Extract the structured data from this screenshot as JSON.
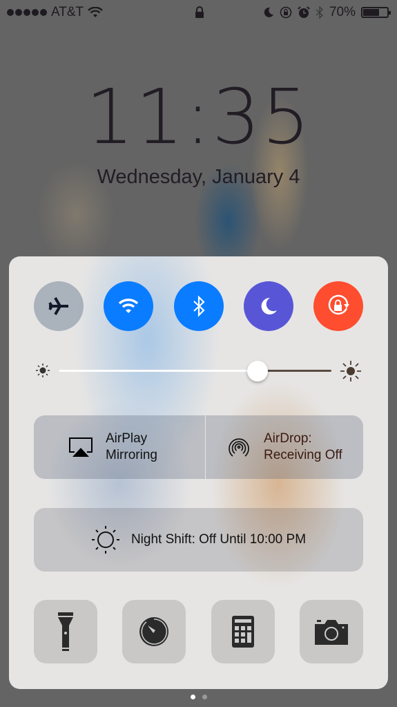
{
  "status_bar": {
    "carrier": "AT&T",
    "signal_bars": 5,
    "battery_percent": "70%",
    "battery_level": 0.7
  },
  "lock_screen": {
    "time": "11:35",
    "date": "Wednesday, January 4"
  },
  "control_center": {
    "toggles": [
      {
        "id": "airplane",
        "icon": "airplane-icon",
        "state": "off",
        "color": "#9aa6b6"
      },
      {
        "id": "wifi",
        "icon": "wifi-icon",
        "state": "on",
        "color": "#0a7cff"
      },
      {
        "id": "bluetooth",
        "icon": "bluetooth-icon",
        "state": "on",
        "color": "#0a7cff"
      },
      {
        "id": "do-not-disturb",
        "icon": "moon-icon",
        "state": "on",
        "color": "#5856d6"
      },
      {
        "id": "rotation-lock",
        "icon": "rotation-lock-icon",
        "state": "on",
        "color": "#fe4d2f"
      }
    ],
    "brightness": {
      "value": 0.73
    },
    "airplay": {
      "line1": "AirPlay",
      "line2": "Mirroring"
    },
    "airdrop": {
      "line1": "AirDrop:",
      "line2": "Receiving Off"
    },
    "night_shift": {
      "label": "Night Shift: Off Until 10:00 PM"
    },
    "apps": [
      {
        "id": "flashlight",
        "icon": "flashlight-icon"
      },
      {
        "id": "timer",
        "icon": "timer-icon"
      },
      {
        "id": "calculator",
        "icon": "calculator-icon"
      },
      {
        "id": "camera",
        "icon": "camera-icon"
      }
    ],
    "pages": {
      "count": 2,
      "current": 1
    }
  }
}
